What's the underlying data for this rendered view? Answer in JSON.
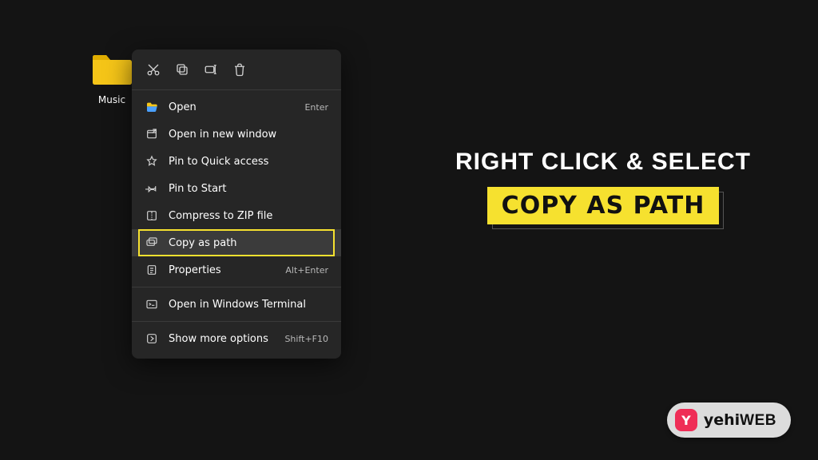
{
  "folder": {
    "label": "Music"
  },
  "menu": {
    "toolbar": [
      "cut",
      "copy",
      "rename",
      "delete"
    ],
    "items": [
      {
        "id": "open",
        "label": "Open",
        "shortcut": "Enter"
      },
      {
        "id": "open-new",
        "label": "Open in new window",
        "shortcut": ""
      },
      {
        "id": "pin-quick",
        "label": "Pin to Quick access",
        "shortcut": ""
      },
      {
        "id": "pin-start",
        "label": "Pin to Start",
        "shortcut": ""
      },
      {
        "id": "zip",
        "label": "Compress to ZIP file",
        "shortcut": ""
      },
      {
        "id": "copy-path",
        "label": "Copy as path",
        "shortcut": "",
        "highlighted": true
      },
      {
        "id": "properties",
        "label": "Properties",
        "shortcut": "Alt+Enter"
      },
      {
        "id": "terminal",
        "label": "Open in Windows Terminal",
        "shortcut": "",
        "group": "after-sep"
      },
      {
        "id": "more",
        "label": "Show more options",
        "shortcut": "Shift+F10",
        "group": "after-sep2"
      }
    ]
  },
  "heading": {
    "line1": "RIGHT CLICK & SELECT",
    "line2": "COPY AS PATH"
  },
  "logo": {
    "badge": "Y",
    "part1": "yehi",
    "part2": "WEB"
  }
}
